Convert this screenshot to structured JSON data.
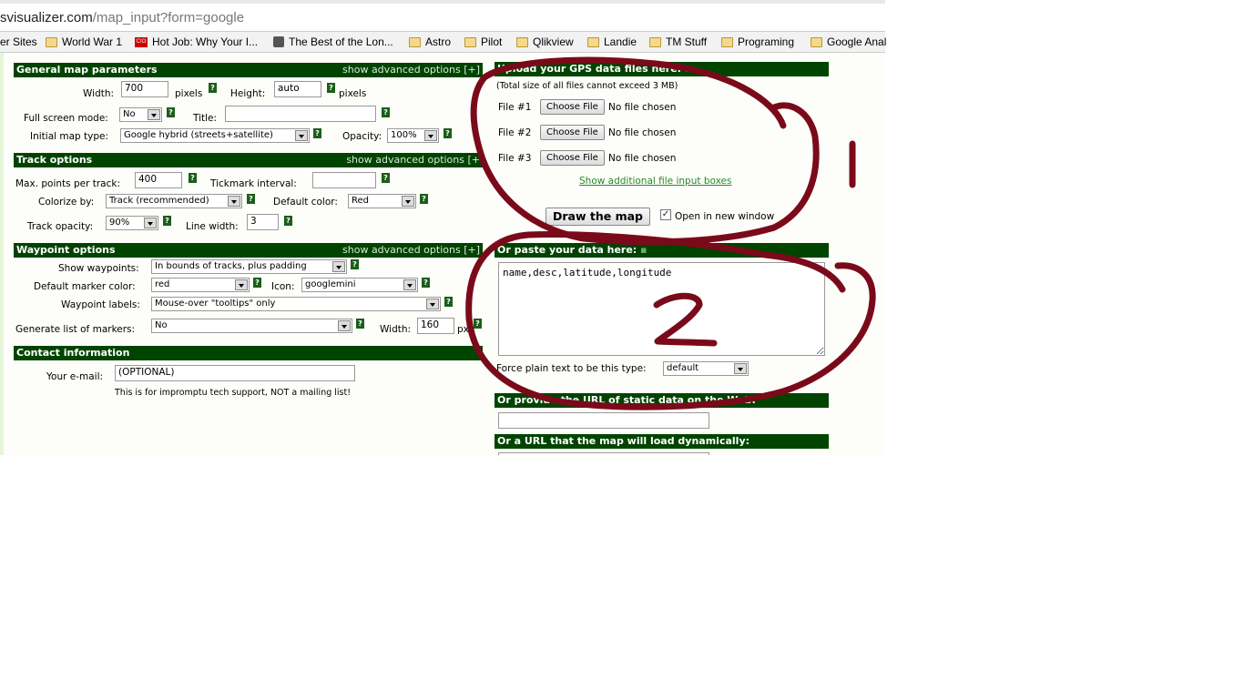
{
  "browser": {
    "url_host": "svisualizer.com",
    "url_path": "/map_input?form=google",
    "bookmarks": [
      {
        "label": "er Sites",
        "icon": "none"
      },
      {
        "label": "World War 1",
        "icon": "folder-icon"
      },
      {
        "label": "Hot Job: Why Your I...",
        "icon": "cio-icon"
      },
      {
        "label": "The Best of the Lon...",
        "icon": "site-icon"
      },
      {
        "label": "Astro",
        "icon": "folder-icon"
      },
      {
        "label": "Pilot",
        "icon": "folder-icon"
      },
      {
        "label": "Qlikview",
        "icon": "folder-icon"
      },
      {
        "label": "Landie",
        "icon": "folder-icon"
      },
      {
        "label": "TM Stuff",
        "icon": "folder-icon"
      },
      {
        "label": "Programing",
        "icon": "folder-icon"
      },
      {
        "label": "Google Anal",
        "icon": "folder-icon"
      }
    ]
  },
  "general": {
    "title": "General map parameters",
    "advanced": "show advanced options [+]",
    "width_label": "Width:",
    "width_value": "700",
    "pixels": "pixels",
    "height_label": "Height:",
    "height_value": "auto",
    "fullscreen_label": "Full screen mode:",
    "fullscreen_value": "No",
    "title_label": "Title:",
    "title_value": "",
    "maptype_label": "Initial map type:",
    "maptype_value": "Google hybrid (streets+satellite)",
    "opacity_label": "Opacity:",
    "opacity_value": "100%"
  },
  "track": {
    "title": "Track options",
    "advanced": "show advanced options [+",
    "maxpoints_label": "Max. points per track:",
    "maxpoints_value": "400",
    "tick_label": "Tickmark interval:",
    "tick_value": "",
    "colorize_label": "Colorize by:",
    "colorize_value": "Track (recommended)",
    "defcolor_label": "Default color:",
    "defcolor_value": "Red",
    "opacity_label": "Track opacity:",
    "opacity_value": "90%",
    "linewidth_label": "Line width:",
    "linewidth_value": "3"
  },
  "waypoint": {
    "title": "Waypoint options",
    "advanced": "show advanced options [+]",
    "show_label": "Show waypoints:",
    "show_value": "In bounds of tracks, plus padding",
    "marker_label": "Default marker color:",
    "marker_value": "red",
    "icon_label": "Icon:",
    "icon_value": "googlemini",
    "labels_label": "Waypoint labels:",
    "labels_value": "Mouse-over \"tooltips\" only",
    "list_label": "Generate list of markers:",
    "list_value": "No",
    "width_label": "Width:",
    "width_value": "160",
    "px": "px"
  },
  "contact": {
    "title": "Contact information",
    "email_label": "Your e-mail:",
    "email_value": "(OPTIONAL)",
    "note": "This is for impromptu tech support, NOT a mailing list!"
  },
  "upload": {
    "title": "Upload your GPS data files here:",
    "note": "(Total size of all files cannot exceed 3 MB)",
    "files": [
      {
        "label": "File #1",
        "button": "Choose File",
        "status": "No file chosen"
      },
      {
        "label": "File #2",
        "button": "Choose File",
        "status": "No file chosen"
      },
      {
        "label": "File #3",
        "button": "Choose File",
        "status": "No file chosen"
      }
    ],
    "more_link": "Show additional file input boxes",
    "draw_button": "Draw the map",
    "newwindow_label": "Open in new window",
    "newwindow_checked": true
  },
  "paste": {
    "title": "Or paste your data here:",
    "text": "name,desc,latitude,longitude",
    "force_label": "Force plain text to be this type:",
    "force_value": "default"
  },
  "static_url": {
    "title": "Or provide the URL of static data on the Web:",
    "value": ""
  },
  "dynamic_url": {
    "title": "Or a URL that the map will load dynamically:"
  },
  "annotations": {
    "color": "#7a0a1a",
    "labels": [
      "1",
      "2"
    ]
  }
}
